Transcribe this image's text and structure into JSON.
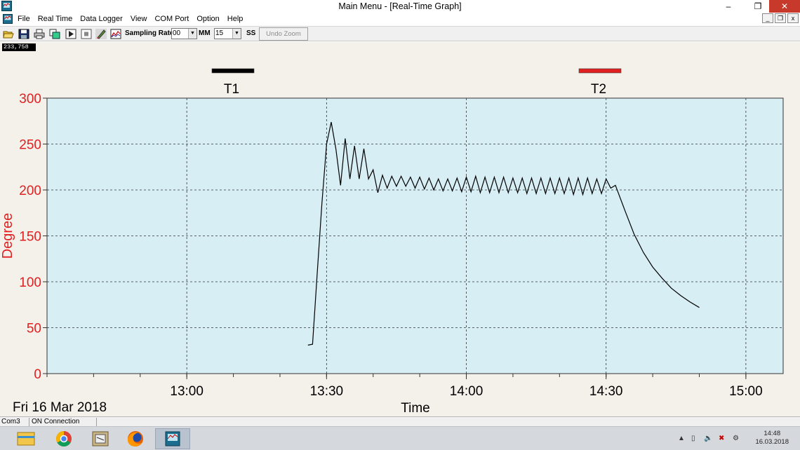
{
  "window": {
    "title": "Main Menu - [Real-Time Graph]",
    "minimize_glyph": "–",
    "maximize_glyph": "❐",
    "close_glyph": "✕"
  },
  "menu": {
    "items": [
      "File",
      "Real Time",
      "Data Logger",
      "View",
      "COM Port",
      "Option",
      "Help"
    ],
    "mdi_buttons": [
      "_",
      "❐",
      "x"
    ]
  },
  "toolbar": {
    "icons": [
      "open-folder-icon",
      "save-disk-icon",
      "print-icon",
      "copy-icon",
      "play-icon",
      "stop-icon",
      "pen-icon",
      "chart-icon"
    ],
    "sampling_rate_label": "Sampling Rate",
    "minutes_value": "00",
    "mm_label": "MM",
    "seconds_value": "15",
    "ss_label": "SS",
    "undo_zoom_label": "Undo Zoom"
  },
  "counter_value": "233,758",
  "chart_data": {
    "type": "line",
    "ylabel": "Degree",
    "xlabel": "Time",
    "date_label": "Fri 16 Mar 2018",
    "ylim": [
      0,
      300
    ],
    "yticks": [
      0,
      50,
      100,
      150,
      200,
      250,
      300
    ],
    "xlim": [
      "12:30",
      "15:08"
    ],
    "xticks": [
      "13:00",
      "13:30",
      "14:00",
      "14:30",
      "15:00"
    ],
    "grid": true,
    "plot_background": "#d7eef5",
    "axis_label_color": "#e02020",
    "legend": [
      {
        "name": "T1",
        "color": "#000000"
      },
      {
        "name": "T2",
        "color": "#e02020"
      }
    ],
    "series": [
      {
        "name": "T1",
        "color": "#000000",
        "points": [
          [
            "13:26",
            31
          ],
          [
            "13:27",
            32
          ],
          [
            "13:28",
            110
          ],
          [
            "13:29",
            185
          ],
          [
            "13:30",
            250
          ],
          [
            "13:31",
            274
          ],
          [
            "13:32",
            245
          ],
          [
            "13:33",
            205
          ],
          [
            "13:34",
            256
          ],
          [
            "13:35",
            212
          ],
          [
            "13:36",
            248
          ],
          [
            "13:37",
            212
          ],
          [
            "13:38",
            245
          ],
          [
            "13:39",
            212
          ],
          [
            "13:40",
            222
          ],
          [
            "13:41",
            197
          ],
          [
            "13:42",
            216
          ],
          [
            "13:43",
            202
          ],
          [
            "13:44",
            215
          ],
          [
            "13:45",
            204
          ],
          [
            "13:46",
            215
          ],
          [
            "13:47",
            204
          ],
          [
            "13:48",
            214
          ],
          [
            "13:49",
            202
          ],
          [
            "13:50",
            214
          ],
          [
            "13:51",
            201
          ],
          [
            "13:52",
            213
          ],
          [
            "13:53",
            200
          ],
          [
            "13:54",
            212
          ],
          [
            "13:55",
            199
          ],
          [
            "13:56",
            212
          ],
          [
            "13:57",
            199
          ],
          [
            "13:58",
            213
          ],
          [
            "13:59",
            198
          ],
          [
            "14:00",
            214
          ],
          [
            "14:01",
            198
          ],
          [
            "14:02",
            215
          ],
          [
            "14:03",
            197
          ],
          [
            "14:04",
            214
          ],
          [
            "14:05",
            197
          ],
          [
            "14:06",
            214
          ],
          [
            "14:07",
            197
          ],
          [
            "14:08",
            214
          ],
          [
            "14:09",
            197
          ],
          [
            "14:10",
            213
          ],
          [
            "14:11",
            197
          ],
          [
            "14:12",
            213
          ],
          [
            "14:13",
            196
          ],
          [
            "14:14",
            213
          ],
          [
            "14:15",
            196
          ],
          [
            "14:16",
            213
          ],
          [
            "14:17",
            196
          ],
          [
            "14:18",
            213
          ],
          [
            "14:19",
            196
          ],
          [
            "14:20",
            213
          ],
          [
            "14:21",
            196
          ],
          [
            "14:22",
            213
          ],
          [
            "14:23",
            195
          ],
          [
            "14:24",
            213
          ],
          [
            "14:25",
            195
          ],
          [
            "14:26",
            213
          ],
          [
            "14:27",
            196
          ],
          [
            "14:28",
            212
          ],
          [
            "14:29",
            196
          ],
          [
            "14:30",
            212
          ],
          [
            "14:31",
            202
          ],
          [
            "14:32",
            205
          ],
          [
            "14:34",
            178
          ],
          [
            "14:36",
            152
          ],
          [
            "14:38",
            132
          ],
          [
            "14:40",
            116
          ],
          [
            "14:42",
            104
          ],
          [
            "14:44",
            93
          ],
          [
            "14:46",
            85
          ],
          [
            "14:48",
            78
          ],
          [
            "14:50",
            72
          ]
        ]
      }
    ]
  },
  "statusbar": {
    "port": "Com3",
    "connection": "ON Connection"
  },
  "taskbar": {
    "apps": [
      "file-explorer-icon",
      "chrome-icon",
      "archive-icon",
      "firefox-icon",
      "realtime-graph-app-icon"
    ],
    "tray_icons": [
      "tray-chevron-icon",
      "tray-device-icon",
      "volume-icon",
      "network-warning-icon",
      "tray-settings-icon"
    ],
    "time": "14:48",
    "date": "16.03.2018"
  }
}
